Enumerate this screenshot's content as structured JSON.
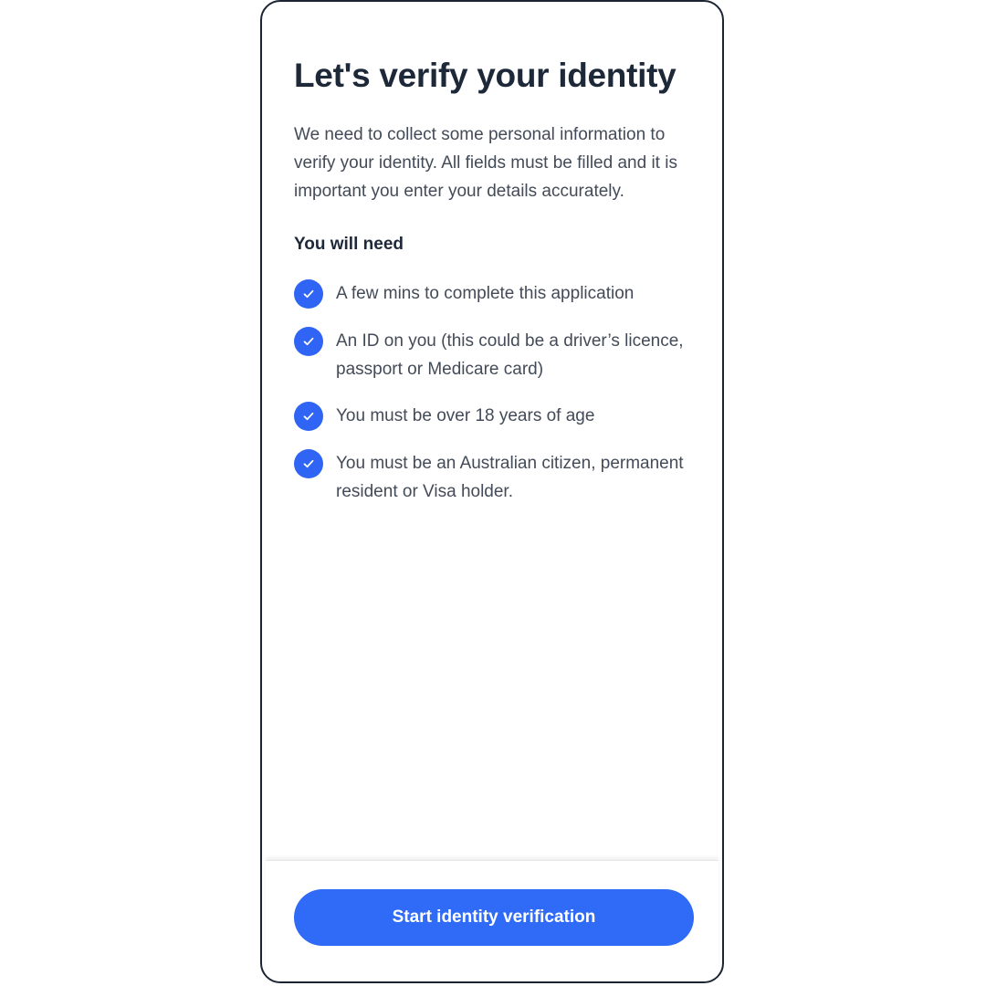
{
  "screen": {
    "title": "Let's verify your identity",
    "intro": "We need to collect some personal information to verify your identity. All fields must be filled and it is important you enter your details accurately.",
    "requirements_heading": "You will need",
    "requirements": [
      {
        "icon": "check-circle-icon",
        "text": "A few mins to complete this application"
      },
      {
        "icon": "check-circle-icon",
        "text": "An ID on you (this could be a driver’s licence, passport or Medicare card)"
      },
      {
        "icon": "check-circle-icon",
        "text": "You must be over 18 years of age"
      },
      {
        "icon": "check-circle-icon",
        "text": "You must be an Australian citizen, permanent resident or Visa holder."
      }
    ]
  },
  "footer": {
    "cta_label": "Start identity verification"
  },
  "colors": {
    "accent": "#2f6bf6",
    "heading": "#1d2838",
    "body_text": "#434b58",
    "frame_border": "#1b2433"
  }
}
